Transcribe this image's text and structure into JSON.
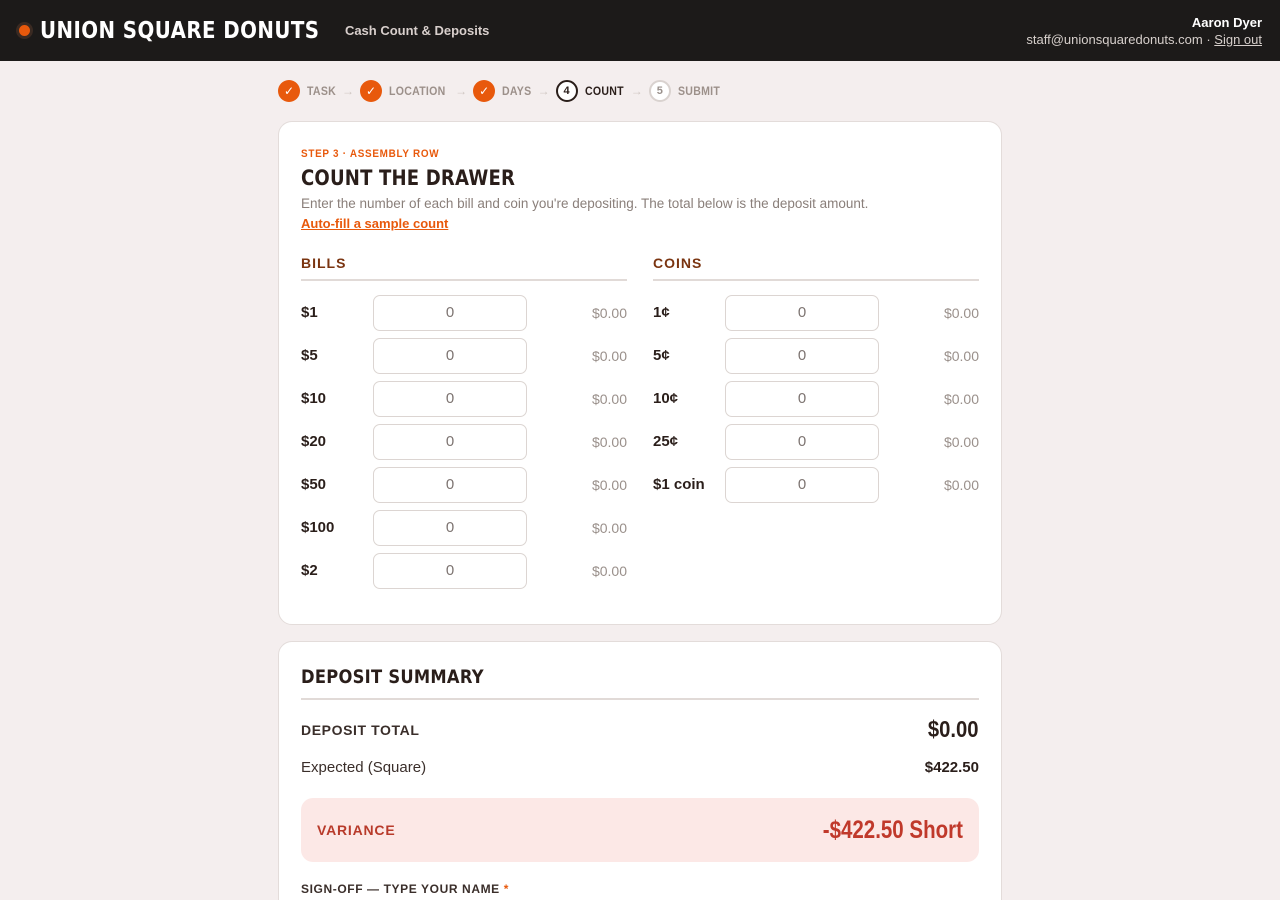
{
  "header": {
    "brand": "UNION SQUARE DONUTS",
    "subtitle": "Cash Count & Deposits",
    "user_name": "Aaron Dyer",
    "user_email": "staff@unionsquaredonuts.com",
    "separator": "·",
    "sign_out": "Sign out"
  },
  "stepper": {
    "arrow": "→",
    "steps": [
      {
        "marker": "✓",
        "label": "TASK",
        "state": "done"
      },
      {
        "marker": "✓",
        "label": "LOCATION",
        "state": "done"
      },
      {
        "marker": "✓",
        "label": "DAYS",
        "state": "done"
      },
      {
        "marker": "4",
        "label": "COUNT",
        "state": "active"
      },
      {
        "marker": "5",
        "label": "SUBMIT",
        "state": "todo"
      }
    ]
  },
  "count_card": {
    "eyebrow": "STEP 3 · ASSEMBLY ROW",
    "title": "COUNT THE DRAWER",
    "description": "Enter the number of each bill and coin you're depositing. The total below is the deposit amount.",
    "autofill_link": "Auto-fill a sample count",
    "bills": {
      "heading": "BILLS",
      "rows": [
        {
          "label": "$1",
          "value": "0",
          "amount": "$0.00"
        },
        {
          "label": "$5",
          "value": "0",
          "amount": "$0.00"
        },
        {
          "label": "$10",
          "value": "0",
          "amount": "$0.00"
        },
        {
          "label": "$20",
          "value": "0",
          "amount": "$0.00"
        },
        {
          "label": "$50",
          "value": "0",
          "amount": "$0.00"
        },
        {
          "label": "$100",
          "value": "0",
          "amount": "$0.00"
        },
        {
          "label": "$2",
          "value": "0",
          "amount": "$0.00"
        }
      ]
    },
    "coins": {
      "heading": "COINS",
      "rows": [
        {
          "label": "1¢",
          "value": "0",
          "amount": "$0.00"
        },
        {
          "label": "5¢",
          "value": "0",
          "amount": "$0.00"
        },
        {
          "label": "10¢",
          "value": "0",
          "amount": "$0.00"
        },
        {
          "label": "25¢",
          "value": "0",
          "amount": "$0.00"
        },
        {
          "label": "$1 coin",
          "value": "0",
          "amount": "$0.00"
        }
      ]
    }
  },
  "summary": {
    "title": "DEPOSIT SUMMARY",
    "total_label": "DEPOSIT TOTAL",
    "total_value": "$0.00",
    "expected_label": "Expected (Square)",
    "expected_value": "$422.50",
    "variance_label": "VARIANCE",
    "variance_value": "-$422.50 Short",
    "signoff_label": "SIGN-OFF — TYPE YOUR NAME",
    "required_mark": "*"
  },
  "colors": {
    "accent": "#e8590c",
    "header_bg": "#1c1a19",
    "page_bg": "#f4eeee",
    "variance_bg": "#fce8e6",
    "variance_text": "#c0392b"
  }
}
